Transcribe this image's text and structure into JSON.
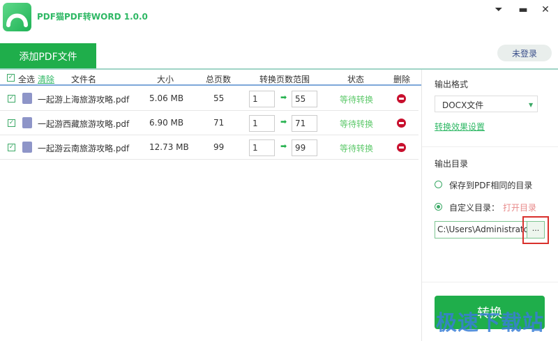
{
  "app": {
    "title": "PDF猫PDF转WORD 1.0.0",
    "window_controls": [
      "menu-icon",
      "minimize-icon",
      "close-icon"
    ]
  },
  "toolbar": {
    "add_label": "添加PDF文件",
    "login_label": "未登录"
  },
  "table": {
    "headers": {
      "select_all": "全选",
      "clear": "清除",
      "name": "文件名",
      "size": "大小",
      "pages": "总页数",
      "range": "转换页数范围",
      "status": "状态",
      "delete": "删除"
    },
    "rows": [
      {
        "checked": true,
        "name": "一起游上海旅游攻略.pdf",
        "size": "5.06 MB",
        "pages": "55",
        "from": "1",
        "to": "55",
        "status": "等待转换"
      },
      {
        "checked": true,
        "name": "一起游西藏旅游攻略.pdf",
        "size": "6.90 MB",
        "pages": "71",
        "from": "1",
        "to": "71",
        "status": "等待转换"
      },
      {
        "checked": true,
        "name": "一起游云南旅游攻略.pdf",
        "size": "12.73 MB",
        "pages": "99",
        "from": "1",
        "to": "99",
        "status": "等待转换"
      }
    ]
  },
  "panel": {
    "format_label": "输出格式",
    "format_value": "DOCX文件",
    "effect_link": "转换效果设置",
    "dir_label": "输出目录",
    "opt_same": "保存到PDF相同的目录",
    "opt_custom": "自定义目录：",
    "open_dir": "打开目录",
    "path_value": "C:\\Users\\Administrator",
    "browse_label": "...",
    "selected_option": "custom",
    "convert_label": "转换"
  },
  "watermark": "极速下载站",
  "colors": {
    "accent": "#1fae4b",
    "status": "#5ec96b",
    "delete": "#c8102e",
    "highlight": "#d9302c"
  }
}
